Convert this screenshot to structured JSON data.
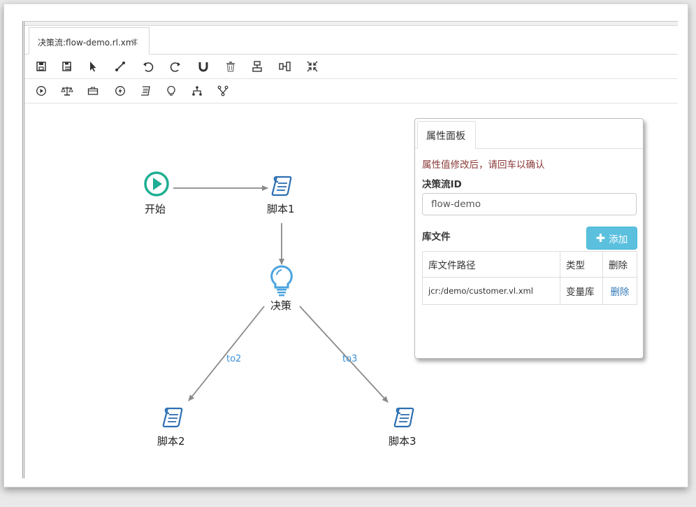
{
  "editor": {
    "tab_title": "决策流:flow-demo.rl.xml",
    "tab_close": "×"
  },
  "toolbar1": [
    "save-icon",
    "save-as-icon",
    "select-pointer-icon",
    "connection-tool-icon",
    "undo-icon",
    "redo-icon",
    "magnet-icon",
    "trash-icon",
    "align-vertical-icon",
    "align-horizontal-icon",
    "collapse-icon"
  ],
  "toolbar2": [
    "start-node-icon",
    "decision-balance-icon",
    "action-toolbox-icon",
    "rule-bolt-icon",
    "script-scroll-icon",
    "decision-bulb-icon",
    "fork-icon",
    "join-icon"
  ],
  "flow": {
    "nodes": {
      "start": "开始",
      "script1": "脚本1",
      "decision": "决策",
      "script2": "脚本2",
      "script3": "脚本3"
    },
    "edges": {
      "to2": "to2",
      "to3": "to3"
    }
  },
  "panel": {
    "tab": "属性面板",
    "hint": "属性值修改后，请回车以确认",
    "id_label": "决策流ID",
    "id_value": "flow-demo",
    "lib_label": "库文件",
    "add_button": "添加",
    "table_headers": {
      "path": "库文件路径",
      "type": "类型",
      "action": "删除"
    },
    "rows": [
      {
        "path": "jcr:/demo/customer.vl.xml",
        "type": "变量库",
        "action": "删除"
      }
    ]
  },
  "colors": {
    "start_node": "#1fae93",
    "script_icon": "#2d6fb3",
    "bulb_icon": "#4aa3df",
    "edge": "#8a8a8a",
    "edge_label": "#3a8fd6",
    "hint": "#8a3a3a",
    "add_button": "#5bc0de"
  }
}
